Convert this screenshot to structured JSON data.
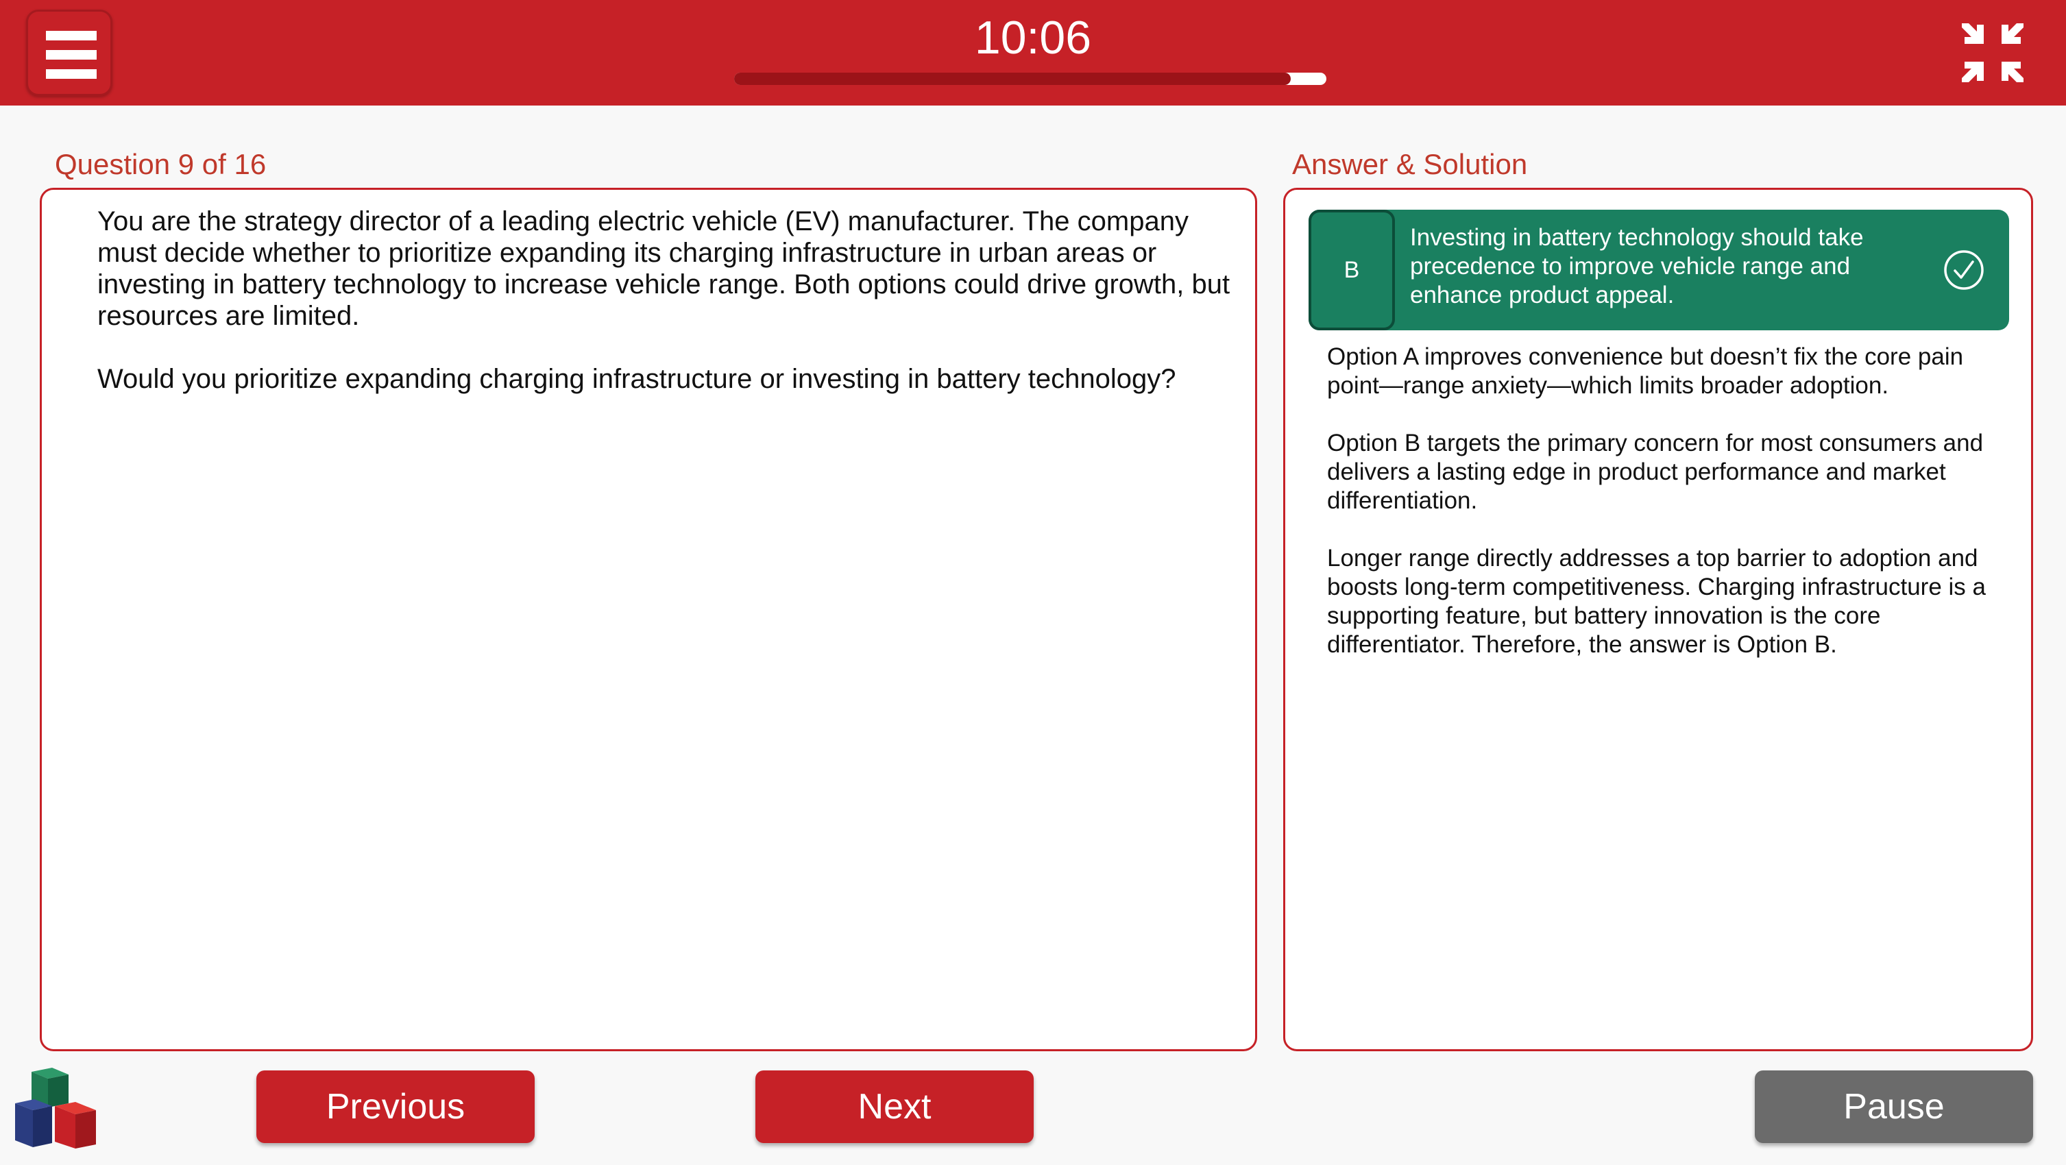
{
  "header": {
    "timer": "10:06",
    "progress": 0.94,
    "menu_icon": "hamburger-menu-icon",
    "collapse_icon": "collapse-arrows-icon"
  },
  "question": {
    "label": "Question 9 of 16",
    "paragraphs": [
      "You are the strategy director of a leading electric vehicle (EV) manufacturer. The company must decide whether to prioritize expanding its charging infrastructure in urban areas or investing in battery technology to increase vehicle range. Both options could drive growth, but resources are limited.",
      "Would you prioritize expanding charging infrastructure or investing in battery technology?"
    ]
  },
  "solution": {
    "label": "Answer & Solution",
    "answer": {
      "letter": "B",
      "text": "Investing in battery technology should take precedence to improve vehicle range and enhance product appeal.",
      "status_icon": "check-circle-icon"
    },
    "paragraphs": [
      "Option A improves convenience but doesn’t fix the core pain point—range anxiety—which limits broader adoption.",
      "Option B targets the primary concern for most consumers and delivers a lasting edge in product performance and market differentiation.",
      "Longer range directly addresses a top barrier to adoption and boosts long-term competitiveness. Charging infrastructure is a supporting feature, but battery innovation is the core differentiator. Therefore, the answer is Option B."
    ]
  },
  "footer": {
    "previous_label": "Previous",
    "next_label": "Next",
    "pause_label": "Pause",
    "logo_icon": "cubes-logo-icon"
  },
  "colors": {
    "brand_red": "#c62127",
    "answer_green": "#1a8060",
    "label_red": "#c0392b",
    "pause_grey": "#6b6b6b"
  }
}
